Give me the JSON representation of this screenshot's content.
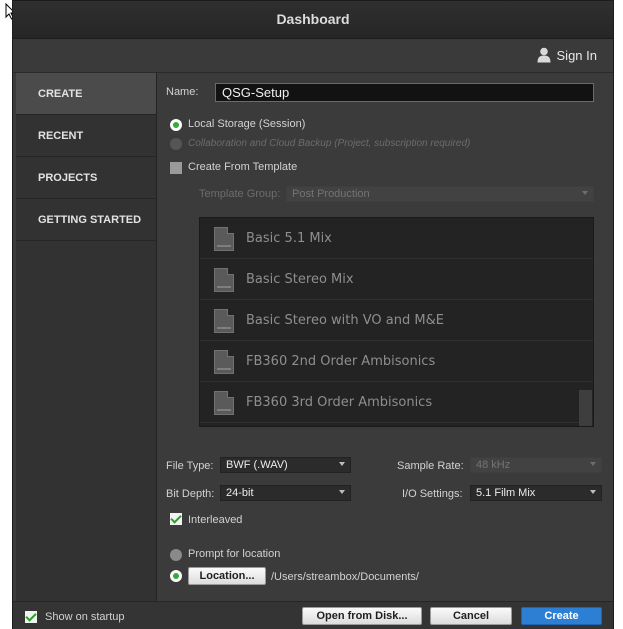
{
  "window": {
    "title": "Dashboard"
  },
  "header": {
    "signin_label": "Sign In"
  },
  "sidebar": {
    "items": [
      {
        "label": "CREATE"
      },
      {
        "label": "RECENT"
      },
      {
        "label": "PROJECTS"
      },
      {
        "label": "GETTING STARTED"
      }
    ]
  },
  "form": {
    "name_label": "Name:",
    "name_value": "QSG-Setup",
    "local_storage_label": "Local Storage (Session)",
    "cloud_label": "Collaboration and Cloud Backup (Project, subscription required)",
    "template_check_label": "Create From Template",
    "template_group_label": "Template Group:",
    "template_group_value": "Post Production",
    "templates": [
      {
        "label": "Basic 5.1 Mix"
      },
      {
        "label": "Basic Stereo Mix"
      },
      {
        "label": "Basic Stereo with VO and M&E"
      },
      {
        "label": "FB360 2nd Order Ambisonics"
      },
      {
        "label": "FB360 3rd Order Ambisonics"
      }
    ],
    "file_type_label": "File Type:",
    "file_type_value": "BWF (.WAV)",
    "sample_rate_label": "Sample Rate:",
    "sample_rate_value": "48 kHz",
    "bit_depth_label": "Bit Depth:",
    "bit_depth_value": "24-bit",
    "io_settings_label": "I/O Settings:",
    "io_settings_value": "5.1 Film Mix",
    "interleaved_label": "Interleaved",
    "prompt_label": "Prompt for location",
    "location_button_label": "Location...",
    "location_path": "/Users/streambox/Documents/"
  },
  "footer": {
    "show_on_startup_label": "Show on startup",
    "open_from_disk_label": "Open from Disk...",
    "cancel_label": "Cancel",
    "create_label": "Create"
  },
  "colors": {
    "accent_blue": "#2d7fd3",
    "radio_green": "#3aa73a"
  }
}
